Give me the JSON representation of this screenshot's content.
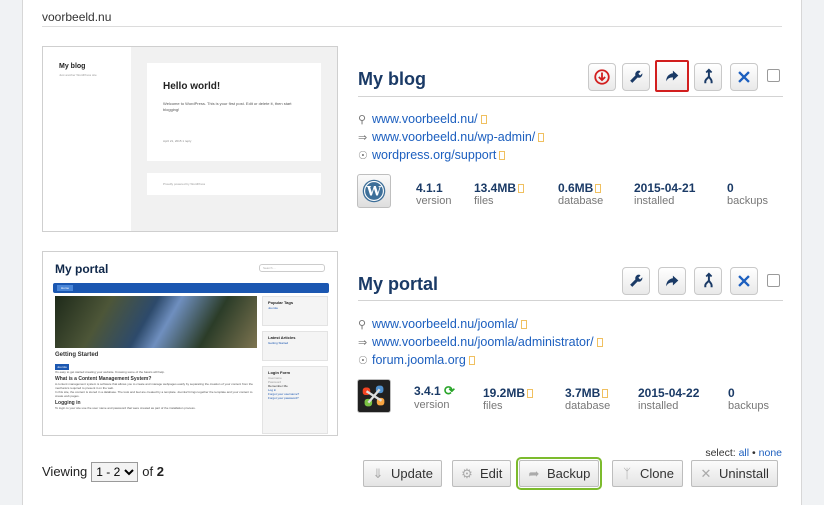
{
  "domain": "voorbeeld.nu",
  "sites": [
    {
      "name": "My blog",
      "thumbnail": {
        "site_title": "My blog",
        "site_tagline": "Just another WordPress site",
        "post_title": "Hello world!",
        "post_body": "Welcome to WordPress. This is your first post. Edit or delete it, then start blogging!",
        "post_meta": "April 21, 2015   1 reply",
        "footer": "Proudly powered by WordPress"
      },
      "links": [
        {
          "icon": "location-pin-icon",
          "text": "www.voorbeeld.nu/"
        },
        {
          "icon": "login-icon",
          "text": "www.voorbeeld.nu/wp-admin/"
        },
        {
          "icon": "support-icon",
          "text": "wordpress.org/support"
        }
      ],
      "stats": {
        "version": "4.1.1",
        "version_label": "version",
        "files": "13.4MB",
        "files_label": "files",
        "database": "0.6MB",
        "database_label": "database",
        "installed": "2015-04-21",
        "installed_label": "installed",
        "backups": "0",
        "backups_label": "backups"
      }
    },
    {
      "name": "My portal",
      "thumbnail": {
        "site_title": "My portal",
        "search_placeholder": "Search ...",
        "nav_item": "Home",
        "article_title": "Getting Started",
        "tag": "Joomla",
        "intro": "It's easy to get started creating your website. Knowing some of the basics will help.",
        "h1": "What is a Content Management System?",
        "p1": "A content management system is software that allows you to create and manage webpages easily by separating the creation of your content from the mechanics required to present it on the web.",
        "p2": "In this site, the content is stored in a database. The look and feel are created by a template. Joomla! brings together the template and your content to create web pages.",
        "h2": "Logging in",
        "p3": "To login to your site use the user name and password that were created as part of the installation process.",
        "mod1_title": "Popular Tags",
        "mod1_item": "Joomla",
        "mod2_title": "Latest Articles",
        "mod2_item": "Getting Started",
        "mod3_title": "Login Form",
        "mod3_user": "Username",
        "mod3_pass": "Password",
        "mod3_remember": "Remember Me",
        "mod3_button": "Log in",
        "mod3_forgot1": "Forgot your username?",
        "mod3_forgot2": "Forgot your password?"
      },
      "links": [
        {
          "icon": "location-pin-icon",
          "text": "www.voorbeeld.nu/joomla/"
        },
        {
          "icon": "login-icon",
          "text": "www.voorbeeld.nu/joomla/administrator/"
        },
        {
          "icon": "support-icon",
          "text": "forum.joomla.org"
        }
      ],
      "stats": {
        "version": "3.4.1",
        "version_label": "version",
        "files": "19.2MB",
        "files_label": "files",
        "database": "3.7MB",
        "database_label": "database",
        "installed": "2015-04-22",
        "installed_label": "installed",
        "backups": "0",
        "backups_label": "backups"
      }
    }
  ],
  "footer": {
    "viewing_label": "Viewing",
    "page_range": "1 - 2",
    "of_label": "of",
    "total": "2",
    "select_label": "select:",
    "select_all": "all",
    "select_sep": "•",
    "select_none": "none",
    "buttons": {
      "update": "Update",
      "edit": "Edit",
      "backup": "Backup",
      "clone": "Clone",
      "uninstall": "Uninstall"
    }
  },
  "colors": {
    "title": "#1a3a66",
    "link": "#1c5fbf",
    "highlight_red": "#d21f1f",
    "highlight_green": "#7cbb2d",
    "update_red": "#d21f1f"
  }
}
